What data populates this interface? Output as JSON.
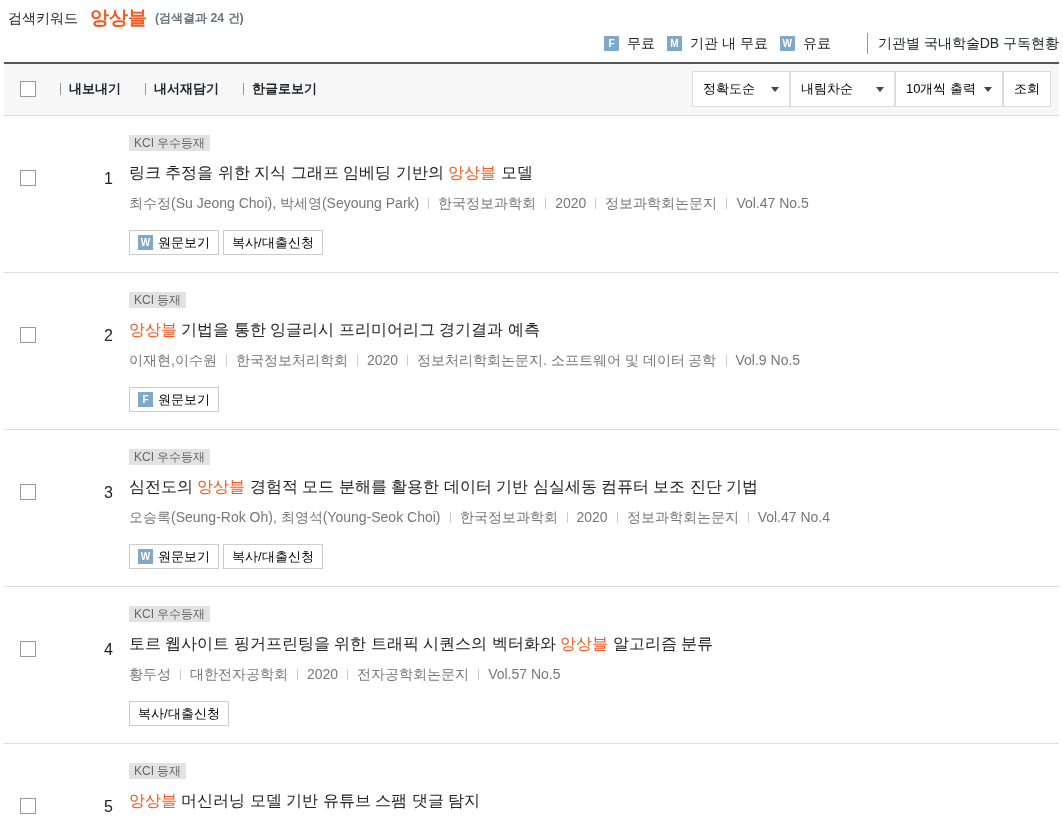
{
  "header": {
    "label": "검색키워드",
    "keyword": "앙상블",
    "result_count": "(검색결과 24 건)"
  },
  "legend": [
    {
      "letter": "F",
      "text": "무료"
    },
    {
      "letter": "M",
      "text": "기관 내 무료"
    },
    {
      "letter": "W",
      "text": "유료"
    }
  ],
  "subscription_link": "기관별 국내학술DB 구독현황",
  "toolbar": {
    "select_all_checked": false,
    "actions": [
      "내보내기",
      "내서재담기",
      "한글로보기"
    ],
    "selects": [
      "정확도순",
      "내림차순",
      "10개씩 출력"
    ],
    "submit": "조회"
  },
  "results": [
    {
      "checked": false,
      "badge": "KCI 우수등재",
      "number": "1",
      "title": [
        {
          "text": "링크 추정을 위한 지식 그래프 임베딩 기반의 ",
          "highlight": false
        },
        {
          "text": "앙상블",
          "highlight": true
        },
        {
          "text": " 모델",
          "highlight": false
        }
      ],
      "meta": [
        "최수정(Su Jeong Choi), 박세영(Seyoung Park)",
        "한국정보과학회",
        "2020",
        "정보과학회논문지",
        "Vol.47 No.5"
      ],
      "buttons": [
        {
          "kind": "fulltext",
          "letter": "W",
          "label": "원문보기"
        },
        {
          "kind": "copy",
          "label": "복사/대출신청"
        }
      ]
    },
    {
      "checked": false,
      "badge": "KCI 등재",
      "number": "2",
      "title": [
        {
          "text": "앙상블",
          "highlight": true
        },
        {
          "text": " 기법을 통한 잉글리시 프리미어리그 경기결과 예측",
          "highlight": false
        }
      ],
      "meta": [
        "이재현,이수원",
        "한국정보처리학회",
        "2020",
        "정보처리학회논문지. 소프트웨어 및 데이터 공학",
        "Vol.9 No.5"
      ],
      "buttons": [
        {
          "kind": "fulltext",
          "letter": "F",
          "label": "원문보기"
        }
      ]
    },
    {
      "checked": false,
      "badge": "KCI 우수등재",
      "number": "3",
      "title": [
        {
          "text": "심전도의 ",
          "highlight": false
        },
        {
          "text": "앙상블",
          "highlight": true
        },
        {
          "text": " 경험적 모드 분해를 활용한 데이터 기반 심실세동 컴퓨터 보조 진단 기법",
          "highlight": false
        }
      ],
      "meta": [
        "오승록(Seung-Rok Oh), 최영석(Young-Seok Choi)",
        "한국정보과학회",
        "2020",
        "정보과학회논문지",
        "Vol.47 No.4"
      ],
      "buttons": [
        {
          "kind": "fulltext",
          "letter": "W",
          "label": "원문보기"
        },
        {
          "kind": "copy",
          "label": "복사/대출신청"
        }
      ]
    },
    {
      "checked": false,
      "badge": "KCI 우수등재",
      "number": "4",
      "title": [
        {
          "text": "토르 웹사이트 핑거프린팅을 위한 트래픽 시퀀스의 벡터화와 ",
          "highlight": false
        },
        {
          "text": "앙상블",
          "highlight": true
        },
        {
          "text": " 알고리즘 분류",
          "highlight": false
        }
      ],
      "meta": [
        "황두성",
        "대한전자공학회",
        "2020",
        "전자공학회논문지",
        "Vol.57 No.5"
      ],
      "buttons": [
        {
          "kind": "copy",
          "label": "복사/대출신청"
        }
      ]
    },
    {
      "checked": false,
      "badge": "KCI 등재",
      "number": "5",
      "title": [
        {
          "text": "앙상블",
          "highlight": true
        },
        {
          "text": " 머신러닝 모델 기반 유튜브 스팸 댓글 탐지",
          "highlight": false
        }
      ]
    }
  ]
}
